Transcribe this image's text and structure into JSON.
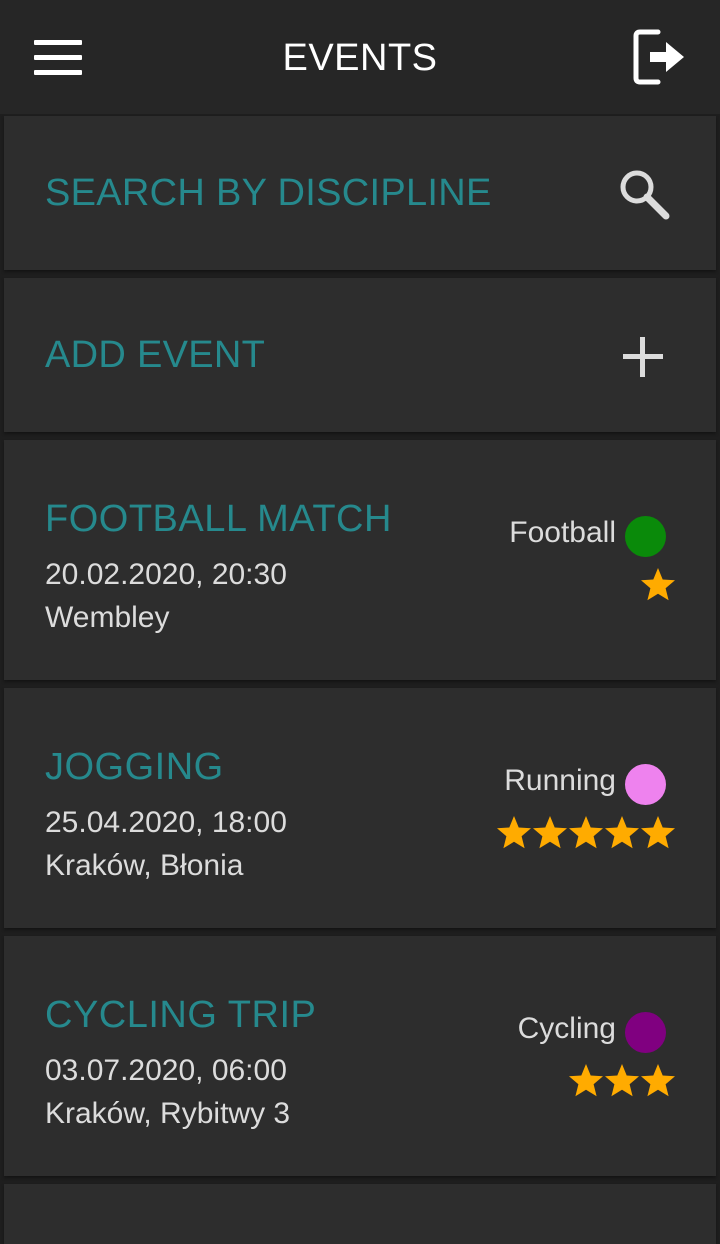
{
  "header": {
    "title": "EVENTS",
    "menu_icon": "hamburger-menu-icon",
    "logout_icon": "logout-icon"
  },
  "search": {
    "label": "SEARCH BY DISCIPLINE",
    "icon": "search-icon"
  },
  "add_event": {
    "label": "ADD EVENT",
    "icon": "plus-icon"
  },
  "colors": {
    "accent": "#26898d",
    "star": "#ffab00",
    "background": "#1e1e1e",
    "card": "#2d2d2d",
    "app_bar": "#262626"
  },
  "events": [
    {
      "title": "FOOTBALL MATCH",
      "datetime": "20.02.2020, 20:30",
      "location": "Wembley",
      "discipline": "Football",
      "discipline_color": "#0a8a0a",
      "rating": 1
    },
    {
      "title": "JOGGING",
      "datetime": "25.04.2020, 18:00",
      "location": "Kraków, Błonia",
      "discipline": "Running",
      "discipline_color": "#ee82ee",
      "rating": 5
    },
    {
      "title": "CYCLING TRIP",
      "datetime": "03.07.2020, 06:00",
      "location": "Kraków, Rybitwy 3",
      "discipline": "Cycling",
      "discipline_color": "#800080",
      "rating": 3
    }
  ]
}
